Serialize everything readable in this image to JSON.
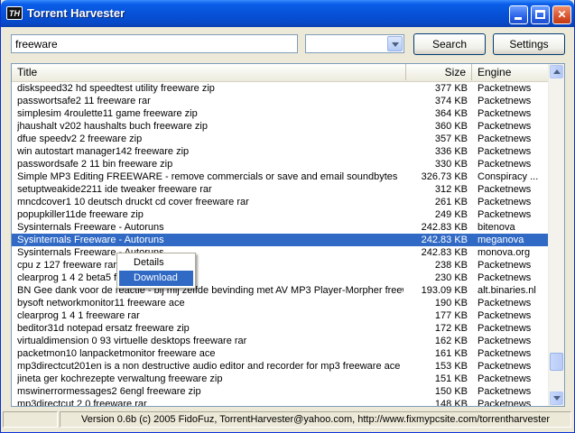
{
  "window": {
    "title": "Torrent Harvester",
    "icon_text": "TH"
  },
  "toolbar": {
    "search_value": "freeware",
    "engine_select_value": "",
    "search_label": "Search",
    "settings_label": "Settings"
  },
  "table": {
    "columns": {
      "title": "Title",
      "size": "Size",
      "engine": "Engine"
    },
    "selected_index": 12,
    "rows": [
      {
        "title": "diskspeed32 hd speedtest utility freeware zip",
        "size": "377 KB",
        "engine": "Packetnews"
      },
      {
        "title": "passwortsafe2 11 freeware rar",
        "size": "374 KB",
        "engine": "Packetnews"
      },
      {
        "title": "simplesim 4roulette11 game freeware zip",
        "size": "364 KB",
        "engine": "Packetnews"
      },
      {
        "title": "jhaushalt v202 haushalts buch freeware zip",
        "size": "360 KB",
        "engine": "Packetnews"
      },
      {
        "title": "dfue speedv2 2 freeware zip",
        "size": "357 KB",
        "engine": "Packetnews"
      },
      {
        "title": "win autostart manager142 freeware zip",
        "size": "336 KB",
        "engine": "Packetnews"
      },
      {
        "title": "passwordsafe 2 11 bin freeware zip",
        "size": "330 KB",
        "engine": "Packetnews"
      },
      {
        "title": "Simple MP3 Editing FREEWARE - remove commercials or save and email soundbytes",
        "size": "326.73 KB",
        "engine": "Conspiracy ..."
      },
      {
        "title": "setuptweakide2211 ide tweaker freeware rar",
        "size": "312 KB",
        "engine": "Packetnews"
      },
      {
        "title": "mncdcover1 10 deutsch druckt cd cover freeware rar",
        "size": "261 KB",
        "engine": "Packetnews"
      },
      {
        "title": "popupkiller11de freeware zip",
        "size": "249 KB",
        "engine": "Packetnews"
      },
      {
        "title": "Sysinternals Freeware - Autoruns",
        "size": "242.83 KB",
        "engine": "bitenova"
      },
      {
        "title": "Sysinternals Freeware - Autoruns",
        "size": "242.83 KB",
        "engine": "meganova"
      },
      {
        "title": "Sysinternals Freeware - Autoruns",
        "size": "242.83 KB",
        "engine": "monova.org"
      },
      {
        "title": "cpu z 127 freeware rar",
        "size": "238 KB",
        "engine": "Packetnews"
      },
      {
        "title": "clearprog 1 4 2 beta5 freeware rar",
        "size": "230 KB",
        "engine": "Packetnews"
      },
      {
        "title": "BN Gee dank voor de reactie - bij mij zelfde bevinding met AV MP3 Player-Morpher freew...",
        "size": "193.09 KB",
        "engine": "alt.binaries.nl"
      },
      {
        "title": "bysoft networkmonitor11 freeware ace",
        "size": "190 KB",
        "engine": "Packetnews"
      },
      {
        "title": "clearprog 1 4 1 freeware rar",
        "size": "177 KB",
        "engine": "Packetnews"
      },
      {
        "title": "beditor31d notepad ersatz freeware zip",
        "size": "172 KB",
        "engine": "Packetnews"
      },
      {
        "title": "virtualdimension 0 93 virtuelle desktops freeware rar",
        "size": "162 KB",
        "engine": "Packetnews"
      },
      {
        "title": "packetmon10 lanpacketmonitor freeware ace",
        "size": "161 KB",
        "engine": "Packetnews"
      },
      {
        "title": "mp3directcut201en is a non destructive audio editor and recorder for mp3 freeware ace",
        "size": "153 KB",
        "engine": "Packetnews"
      },
      {
        "title": "jineta ger kochrezepte verwaltung freeware zip",
        "size": "151 KB",
        "engine": "Packetnews"
      },
      {
        "title": "mswinerrormessages2 6engl freeware zip",
        "size": "150 KB",
        "engine": "Packetnews"
      },
      {
        "title": "mp3directcut 2 0 freeware rar",
        "size": "148 KB",
        "engine": "Packetnews"
      }
    ]
  },
  "context_menu": {
    "items": [
      {
        "label": "Details"
      },
      {
        "label": "Download"
      }
    ]
  },
  "status": {
    "text": "Version 0.6b (c) 2005 FidoFuz, TorrentHarvester@yahoo.com, http://www.fixmypcsite.com/torrentharvester"
  },
  "colors": {
    "selection": "#316ac5",
    "titlebar": "#0752d8"
  },
  "icons": {
    "minimize": "minimize-icon",
    "maximize": "maximize-icon",
    "close": "close-icon"
  }
}
